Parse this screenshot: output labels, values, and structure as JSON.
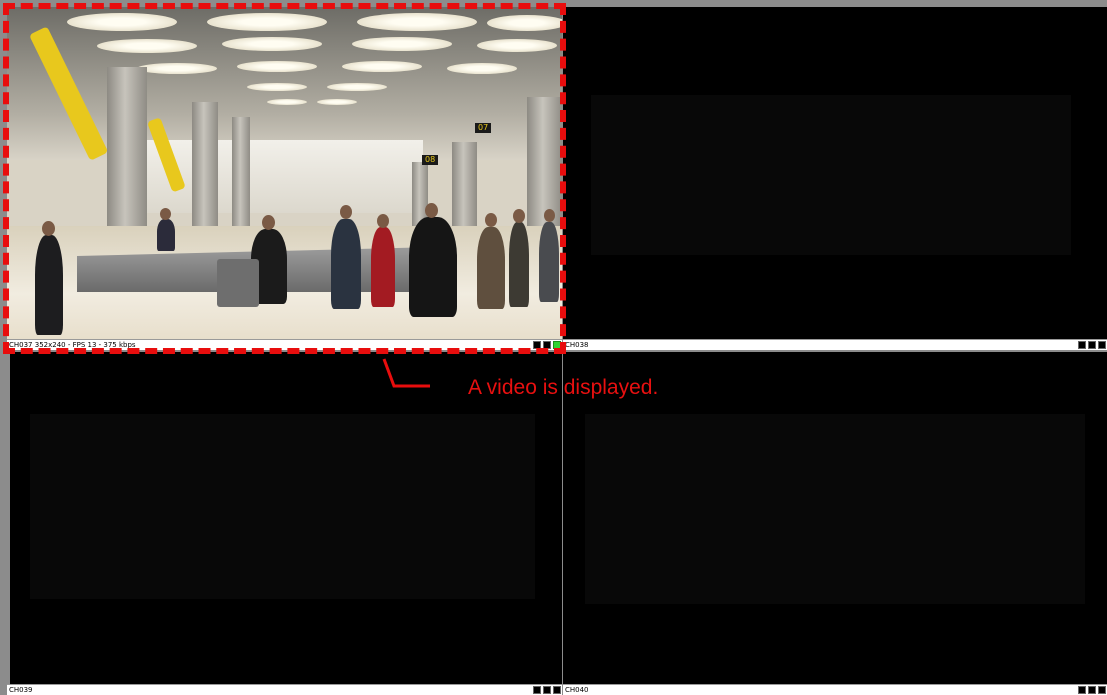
{
  "panes": [
    {
      "label": "CH037 352x240 - FPS 13 - 375 kbps",
      "has_video": true,
      "scene": {
        "signs": [
          "07",
          "08"
        ]
      },
      "indicators": [
        "black",
        "black",
        "green"
      ]
    },
    {
      "label": "CH038",
      "has_video": false,
      "indicators": [
        "black",
        "black",
        "black"
      ]
    },
    {
      "label": "CH039",
      "has_video": false,
      "indicators": [
        "black",
        "black",
        "black"
      ]
    },
    {
      "label": "CH040",
      "has_video": false,
      "indicators": [
        "black",
        "black",
        "black"
      ]
    }
  ],
  "annotation": {
    "text": "A video is displayed.",
    "color": "#e80d0d"
  },
  "colors": {
    "background": "#8c8c8c",
    "video_background": "#000000",
    "status_green": "#31d431"
  }
}
